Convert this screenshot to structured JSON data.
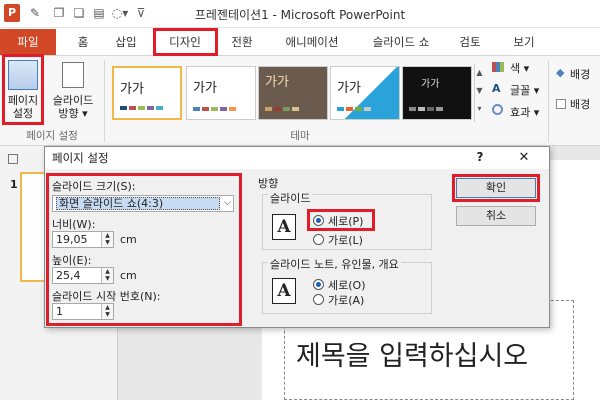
{
  "window": {
    "title": "프레젠테이션1 - Microsoft PowerPoint"
  },
  "tabs": [
    "파일",
    "홈",
    "삽입",
    "디자인",
    "전환",
    "애니메이션",
    "슬라이드 쇼",
    "검토",
    "보기"
  ],
  "ribbon": {
    "page_setup_btn": [
      "페이지",
      "설정"
    ],
    "orientation_btn": [
      "슬라이드",
      "방향 ▾"
    ],
    "page_setup_group": "페이지 설정",
    "theme_group": "테마",
    "themes": [
      "가가",
      "가가",
      "가가",
      "가가",
      "가가"
    ],
    "colors": "색 ▾",
    "fonts": "글꼴 ▾",
    "effects": "효과 ▾",
    "bg1": "배경",
    "bg2": "배경"
  },
  "slide_panel": {
    "number": "1"
  },
  "slide": {
    "placeholder": "제목을 입력하십시오"
  },
  "dialog": {
    "title": "페이지 설정",
    "help": "?",
    "close": "✕",
    "size_label": "슬라이드 크기(S):",
    "size_value": "화면 슬라이드 쇼(4:3)",
    "width_label": "너비(W):",
    "width_value": "19,05",
    "width_unit": "cm",
    "height_label": "높이(E):",
    "height_value": "25,4",
    "height_unit": "cm",
    "start_label": "슬라이드 시작 번호(N):",
    "start_value": "1",
    "orientation_heading": "방향",
    "slides_group": "슬라이드",
    "slides_portrait": "세로(P)",
    "slides_landscape": "가로(L)",
    "notes_group": "슬라이드 노트, 유인물, 개요",
    "notes_portrait": "세로(O)",
    "notes_landscape": "가로(A)",
    "ok": "확인",
    "cancel": "취소"
  },
  "colors_accent": {
    "file_tab": "#d24726",
    "highlight": "#e11d2a"
  }
}
